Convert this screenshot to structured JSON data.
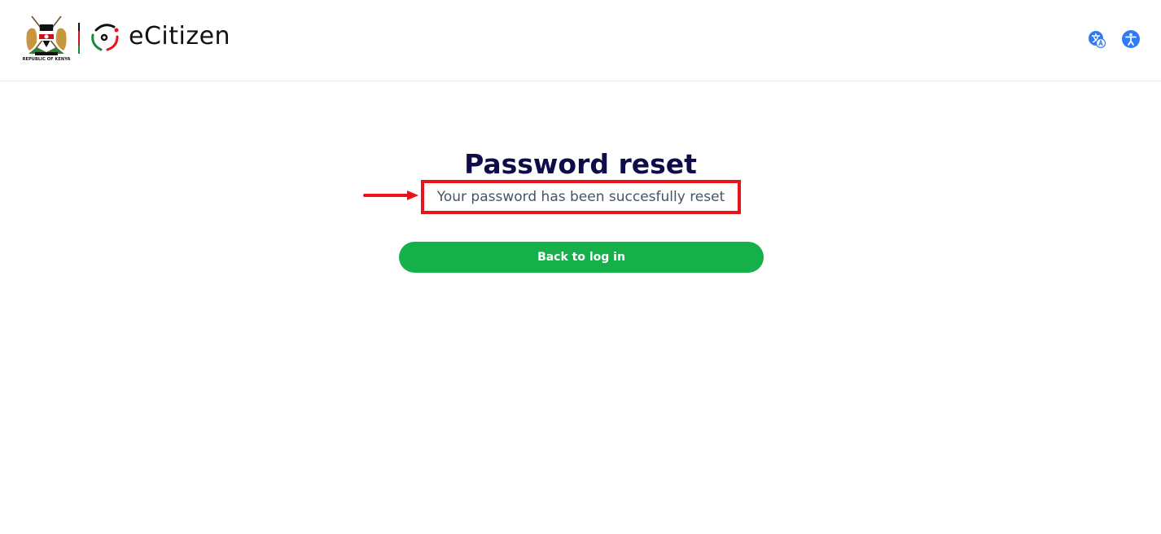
{
  "header": {
    "coat_of_arms_caption": "REPUBLIC OF KENYA",
    "brand_name": "eCitizen",
    "translate_icon": "translate-icon",
    "accessibility_icon": "accessibility-icon"
  },
  "main": {
    "title": "Password reset",
    "message": "Your password has been succesfully reset",
    "back_button_label": "Back to log in"
  },
  "colors": {
    "title": "#0f0c4a",
    "message": "#475467",
    "button_bg": "#16b04b",
    "button_text": "#ffffff",
    "header_icons": "#2f7bf6",
    "annotation": "#e8141c"
  }
}
